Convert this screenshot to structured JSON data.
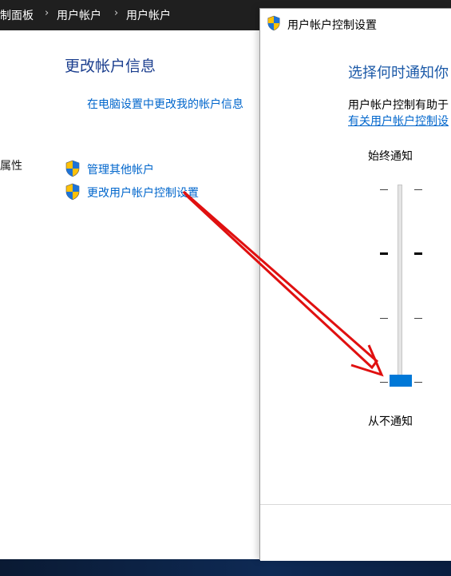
{
  "breadcrumb": {
    "items": [
      "制面板",
      "用户帐户",
      "用户帐户"
    ],
    "separator": "›"
  },
  "main": {
    "section_title": "更改帐户信息",
    "pc_settings_link": "在电脑设置中更改我的帐户信息",
    "left_stub_text": "属性",
    "manage_accounts_link": "管理其他帐户",
    "uac_settings_link": "更改用户帐户控制设置"
  },
  "dialog": {
    "title": "用户帐户控制设置",
    "heading": "选择何时通知你",
    "description": "用户帐户控制有助于",
    "help_link": "有关用户帐户控制设",
    "slider": {
      "top_label": "始终通知",
      "bottom_label": "从不通知",
      "levels": 4,
      "selected_level": 1
    }
  },
  "annotation": {
    "arrow_color": "#e01010"
  },
  "colors": {
    "link": "#0066cc",
    "accent": "#0078d7",
    "heading": "#1c3f8f",
    "taskbar": "#0e2a55"
  },
  "icons": [
    "shield-icon",
    "uac-shield-icon",
    "chevron-right-icon"
  ]
}
